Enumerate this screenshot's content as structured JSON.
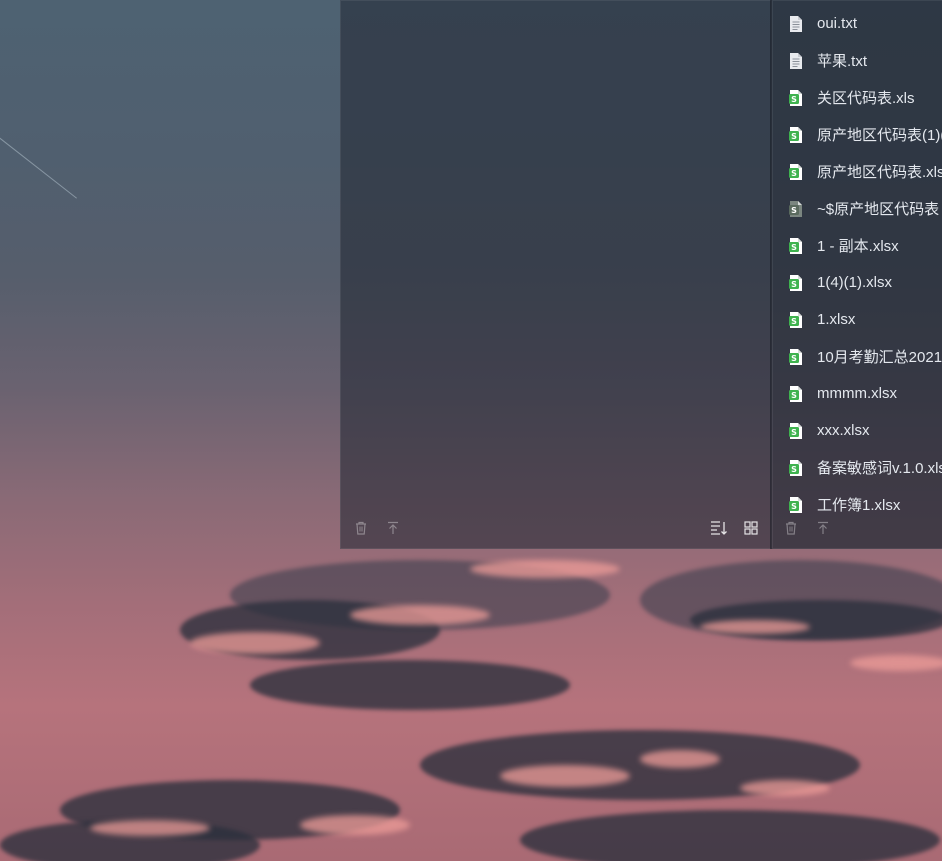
{
  "desktop": {
    "wallpaper": "sunset-sky-clouds"
  },
  "right_panel": {
    "files": [
      {
        "name": "oui.txt",
        "icon": "text-file-icon",
        "kind": "txt"
      },
      {
        "name": "苹果.txt",
        "icon": "text-file-icon",
        "kind": "txt"
      },
      {
        "name": "关区代码表.xls",
        "icon": "spreadsheet-file-icon",
        "kind": "xls"
      },
      {
        "name": "原产地区代码表(1)(",
        "icon": "spreadsheet-file-icon",
        "kind": "xls"
      },
      {
        "name": "原产地区代码表.xls",
        "icon": "spreadsheet-file-icon",
        "kind": "xls"
      },
      {
        "name": "~$原产地区代码表",
        "icon": "spreadsheet-temp-file-icon",
        "kind": "tmp"
      },
      {
        "name": "1 - 副本.xlsx",
        "icon": "spreadsheet-file-icon",
        "kind": "xls"
      },
      {
        "name": "1(4)(1).xlsx",
        "icon": "spreadsheet-file-icon",
        "kind": "xls"
      },
      {
        "name": "1.xlsx",
        "icon": "spreadsheet-file-icon",
        "kind": "xls"
      },
      {
        "name": "10月考勤汇总2021",
        "icon": "spreadsheet-file-icon",
        "kind": "xls"
      },
      {
        "name": "mmmm.xlsx",
        "icon": "spreadsheet-file-icon",
        "kind": "xls"
      },
      {
        "name": "xxx.xlsx",
        "icon": "spreadsheet-file-icon",
        "kind": "xls"
      },
      {
        "name": "备案敏感词v.1.0.xls",
        "icon": "spreadsheet-file-icon",
        "kind": "xls"
      },
      {
        "name": "工作簿1.xlsx",
        "icon": "spreadsheet-file-icon",
        "kind": "xls"
      }
    ]
  },
  "left_panel": {
    "toolbar_icons": [
      "trash-icon",
      "pin-top-icon",
      "sort-icon",
      "grid-view-icon"
    ]
  },
  "right_toolbar": {
    "icons": [
      "trash-icon",
      "pin-top-icon"
    ]
  },
  "colors": {
    "xls_green": "#3fb34f",
    "txt_gray": "#e8eaee",
    "tmp_dark": "#5a6a5e"
  }
}
